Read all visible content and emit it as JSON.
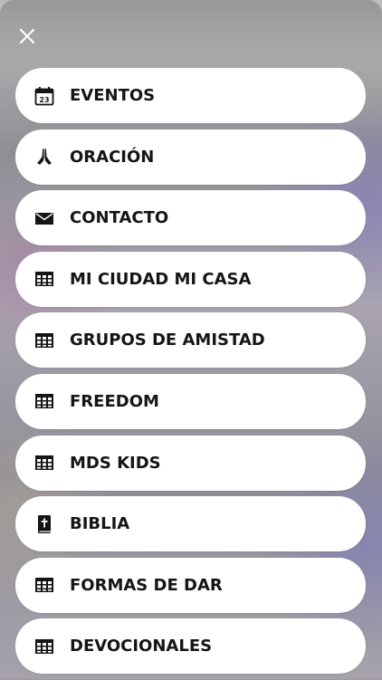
{
  "header": {
    "close_icon": "close-icon"
  },
  "menu": {
    "items": [
      {
        "label": "EVENTOS",
        "icon": "calendar-icon",
        "icon_text": "23"
      },
      {
        "label": "ORACIÓN",
        "icon": "praying-hands-icon"
      },
      {
        "label": "CONTACTO",
        "icon": "envelope-icon"
      },
      {
        "label": "MI CIUDAD MI CASA",
        "icon": "table-icon"
      },
      {
        "label": "GRUPOS DE AMISTAD",
        "icon": "table-icon"
      },
      {
        "label": "FREEDOM",
        "icon": "table-icon"
      },
      {
        "label": "MDS KIDS",
        "icon": "table-icon"
      },
      {
        "label": "BIBLIA",
        "icon": "bible-icon"
      },
      {
        "label": "FORMAS DE DAR",
        "icon": "table-icon"
      },
      {
        "label": "DEVOCIONALES",
        "icon": "table-icon"
      }
    ]
  },
  "colors": {
    "item_background": "#ffffff",
    "text": "#151515",
    "icon": "#151515"
  }
}
